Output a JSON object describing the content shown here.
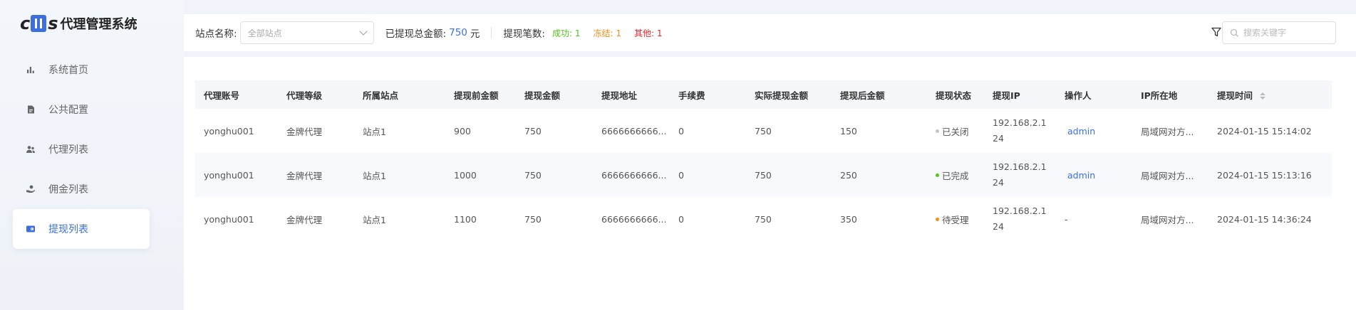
{
  "app": {
    "logo_text": "代理管理系统"
  },
  "sidebar": {
    "items": [
      {
        "label": "系统首页",
        "icon": "bar-chart-icon",
        "active": false
      },
      {
        "label": "公共配置",
        "icon": "document-icon",
        "active": false
      },
      {
        "label": "代理列表",
        "icon": "users-icon",
        "active": false
      },
      {
        "label": "佣金列表",
        "icon": "hand-coin-icon",
        "active": false
      },
      {
        "label": "提现列表",
        "icon": "wallet-icon",
        "active": true
      }
    ]
  },
  "toolbar": {
    "site_label": "站点名称:",
    "site_select_value": "全部站点",
    "total_label": "已提现总金额:",
    "total_value": "750",
    "total_unit": "元",
    "count_label": "提现笔数:",
    "success": "成功: 1",
    "frozen": "冻结: 1",
    "other": "其他: 1",
    "search_placeholder": "搜索关键字"
  },
  "table": {
    "headers": [
      "代理账号",
      "代理等级",
      "所属站点",
      "提现前金额",
      "提现金额",
      "提现地址",
      "手续费",
      "实际提现金额",
      "提现后金额",
      "提现状态",
      "提现IP",
      "操作人",
      "IP所在地",
      "提现时间"
    ],
    "rows": [
      {
        "account": "yonghu001",
        "level": "金牌代理",
        "site": "站点1",
        "before": "900",
        "amount": "750",
        "address": "6666666666...",
        "fee": "0",
        "actual": "750",
        "after": "150",
        "status": "已关闭",
        "status_color": "#c0c4cc",
        "ip": "192.168.2.124",
        "operator": "admin",
        "location": "局域网对方...",
        "time": "2024-01-15 15:14:02"
      },
      {
        "account": "yonghu001",
        "level": "金牌代理",
        "site": "站点1",
        "before": "1000",
        "amount": "750",
        "address": "6666666666...",
        "fee": "0",
        "actual": "750",
        "after": "250",
        "status": "已完成",
        "status_color": "#52c41a",
        "ip": "192.168.2.124",
        "operator": "admin",
        "location": "局域网对方...",
        "time": "2024-01-15 15:13:16"
      },
      {
        "account": "yonghu001",
        "level": "金牌代理",
        "site": "站点1",
        "before": "1100",
        "amount": "750",
        "address": "6666666666...",
        "fee": "0",
        "actual": "750",
        "after": "350",
        "status": "待受理",
        "status_color": "#fa8c16",
        "ip": "192.168.2.124",
        "operator": "-",
        "location": "局域网对方...",
        "time": "2024-01-15 14:36:24"
      }
    ]
  }
}
